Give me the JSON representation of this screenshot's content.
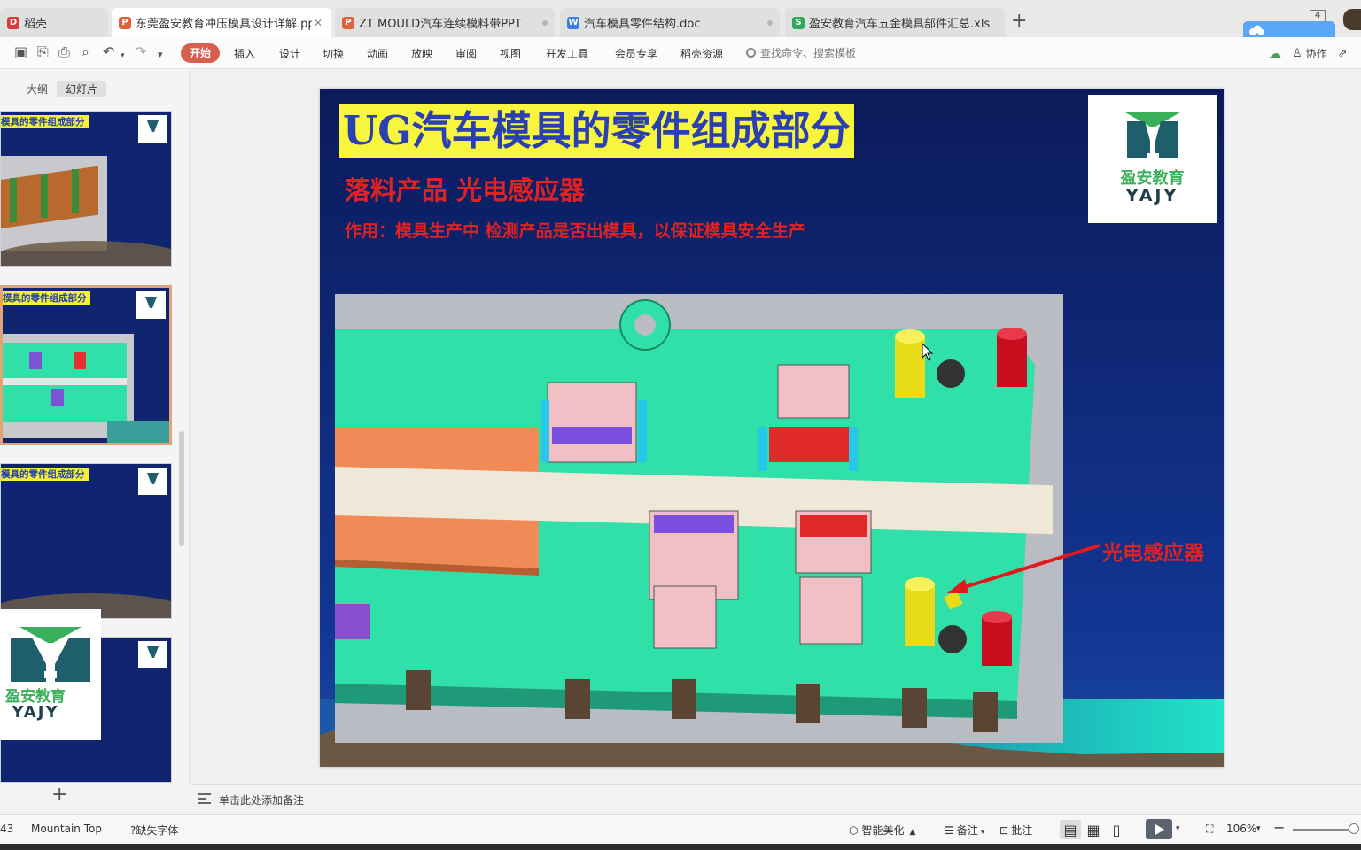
{
  "tabs": [
    {
      "label": "稻壳",
      "icon": "daoke-icon",
      "color": "#d93a3a"
    },
    {
      "label": "东莞盈安教育冲压模具设计详解.pptx",
      "icon": "ppt-file-icon",
      "color": "#e0623c",
      "active": true
    },
    {
      "label": "ZT MOULD汽车连续模料带PPT",
      "icon": "ppt-file-icon",
      "color": "#e0623c"
    },
    {
      "label": "汽车模具零件结构.doc",
      "icon": "doc-file-icon",
      "color": "#3b7de0"
    },
    {
      "label": "盈安教育汽车五金模具部件汇总.xls",
      "icon": "xls-file-icon",
      "color": "#2faa5d"
    }
  ],
  "tab_count": "4",
  "cloud_badge": {
    "label": "",
    "sub": ""
  },
  "menu": {
    "start": "开始",
    "items": [
      "插入",
      "设计",
      "切换",
      "动画",
      "放映",
      "审阅",
      "视图",
      "开发工具",
      "会员专享",
      "稻壳资源"
    ],
    "search_placeholder": "查找命令、搜索模板",
    "collab": "协作"
  },
  "panel": {
    "tab_outline": "大纲",
    "tab_slides": "幻灯片",
    "thumb_title": "模具的零件组成部分"
  },
  "slide": {
    "title": "UG汽车模具的零件组成部分",
    "subtitle": "落料产品 光电感应器",
    "description": "作用：模具生产中 检测产品是否出模具，以保证模具安全生产",
    "callout": "光电感应器",
    "logo_cn": "盈安教育",
    "logo_en": "YAJY"
  },
  "notes": {
    "placeholder": "单击此处添加备注"
  },
  "status": {
    "slide_num": "43",
    "theme": "Mountain Top",
    "missing_font": "缺失字体",
    "beautify": "智能美化",
    "notes": "备注",
    "comment": "批注",
    "zoom": "106%"
  },
  "colors": {
    "accent": "#d6604d",
    "slide_bg": "#0f2a7a",
    "title_bg": "#f8f53e",
    "title_text": "#2a3fb0",
    "red_text": "#e02222",
    "mould_green": "#2fe0a8"
  }
}
